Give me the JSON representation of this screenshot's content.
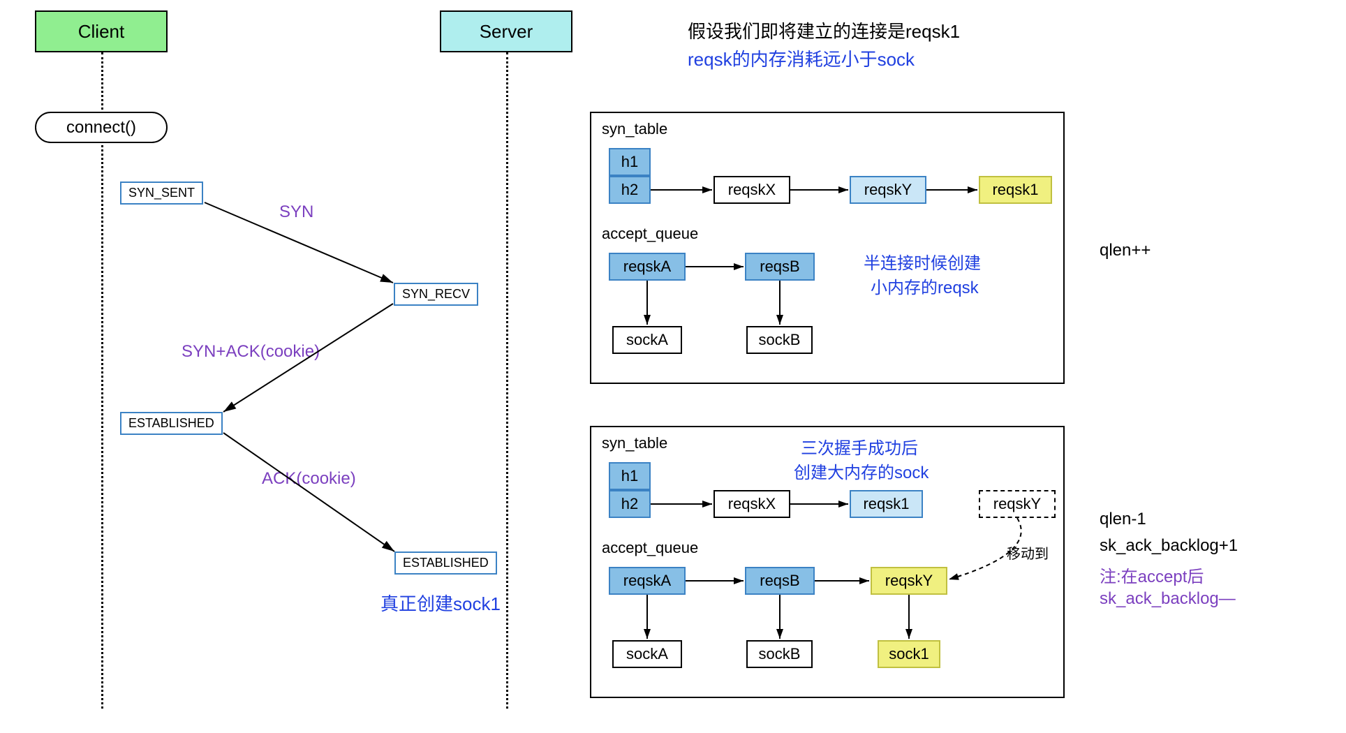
{
  "header": {
    "client": "Client",
    "server": "Server",
    "connect": "connect()",
    "assume": "假设我们即将建立的连接是reqsk1",
    "memnote": "reqsk的内存消耗远小于sock"
  },
  "states": {
    "syn_sent": "SYN_SENT",
    "syn_recv": "SYN_RECV",
    "est1": "ESTABLISHED",
    "est2": "ESTABLISHED"
  },
  "msgs": {
    "syn": "SYN",
    "synack": "SYN+ACK(cookie)",
    "ack": "ACK(cookie)"
  },
  "bottomnote": "真正创建sock1",
  "panel1": {
    "syn_table": "syn_table",
    "h1": "h1",
    "h2": "h2",
    "reqskX": "reqskX",
    "reqskY": "reqskY",
    "reqsk1": "reqsk1",
    "accept_queue": "accept_queue",
    "reqskA": "reqskA",
    "reqsB": "reqsB",
    "sockA": "sockA",
    "sockB": "sockB",
    "note1": "半连接时候创建",
    "note2": "小内存的reqsk",
    "side": "qlen++"
  },
  "panel2": {
    "syn_table": "syn_table",
    "h1": "h1",
    "h2": "h2",
    "reqskX": "reqskX",
    "reqsk1": "reqsk1",
    "reqskY": "reqskY",
    "accept_queue": "accept_queue",
    "reqskA": "reqskA",
    "reqsB": "reqsB",
    "reqskY2": "reqskY",
    "sockA": "sockA",
    "sockB": "sockB",
    "sock1": "sock1",
    "note1": "三次握手成功后",
    "note2": "创建大内存的sock",
    "move": "移动到",
    "side1": "qlen-1",
    "side2": "sk_ack_backlog+1",
    "side3": "注:在accept后",
    "side4": "sk_ack_backlog—"
  }
}
